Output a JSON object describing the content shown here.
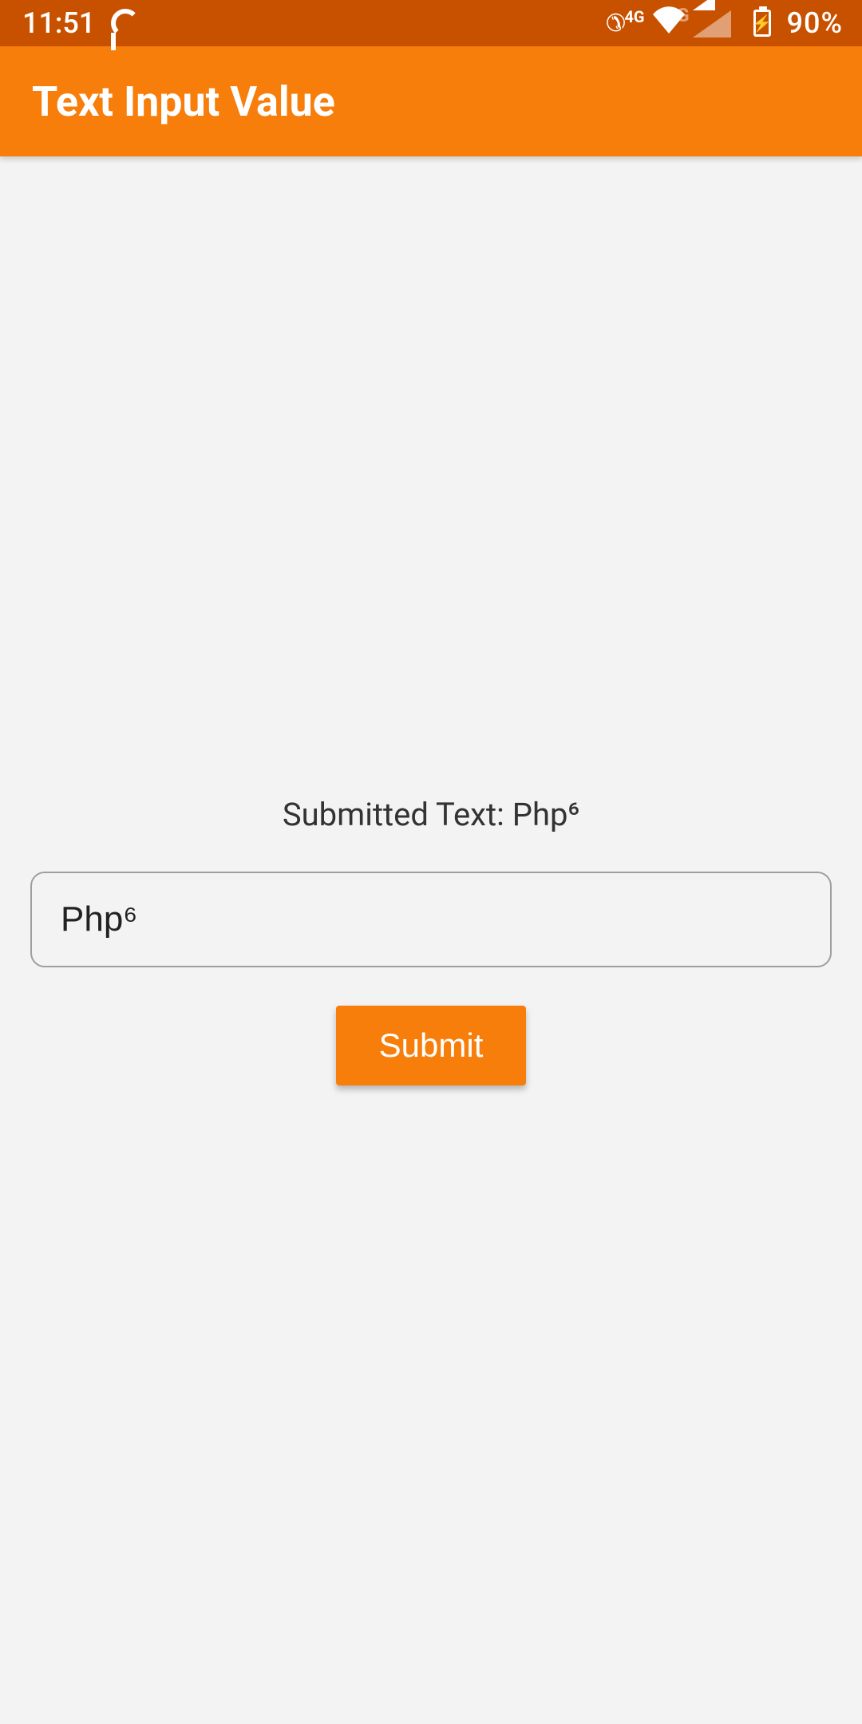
{
  "status_bar": {
    "time": "11:51",
    "network_type_primary": "4G",
    "network_type_secondary": "4G",
    "battery_percent": "90%"
  },
  "app_bar": {
    "title": "Text Input Value"
  },
  "main": {
    "result_prefix": "Submitted Text: ",
    "result_value": "Php⁶",
    "input_value": "Php⁶",
    "submit_label": "Submit"
  }
}
